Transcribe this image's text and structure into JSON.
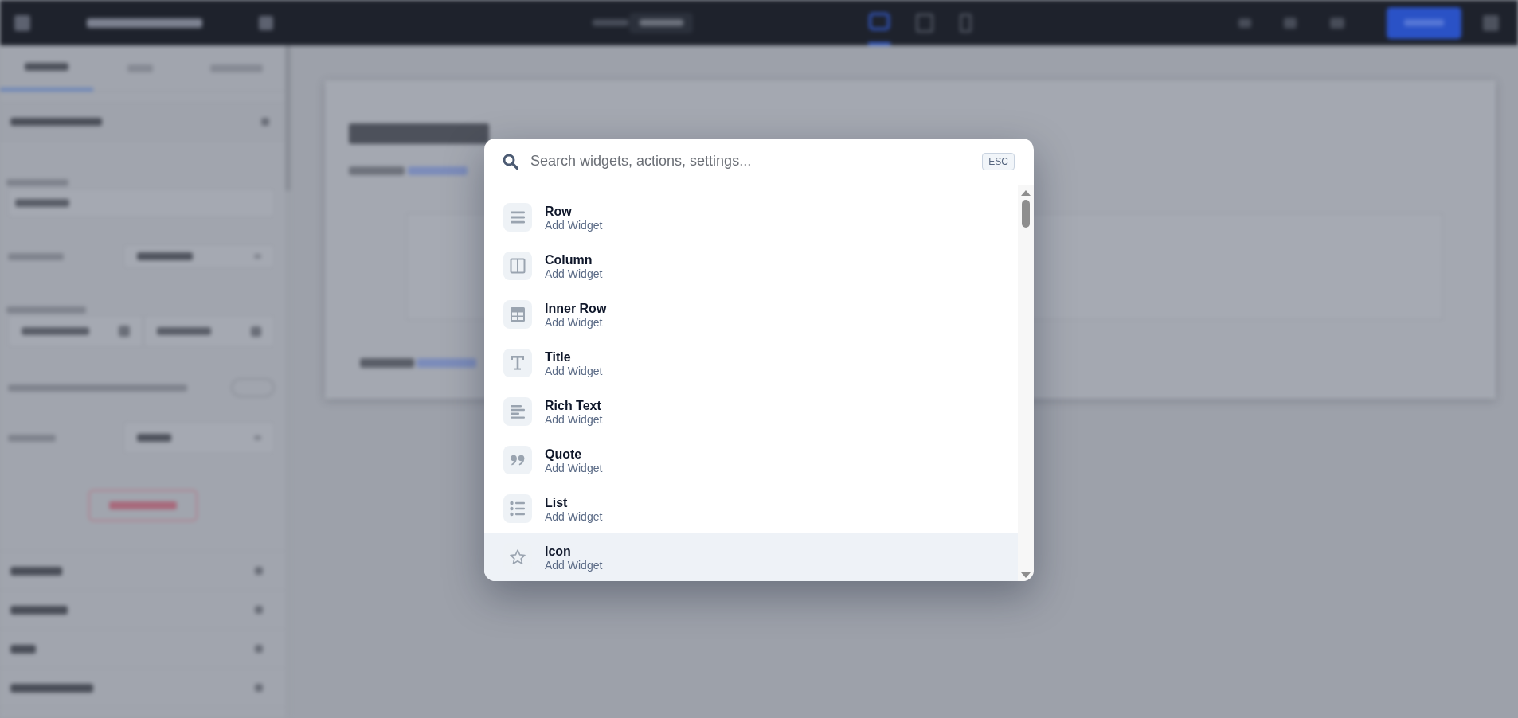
{
  "search": {
    "placeholder": "Search widgets, actions, settings...",
    "shortcut": "ESC"
  },
  "widgets": [
    {
      "kind": "row",
      "title": "Row",
      "subtitle": "Add Widget",
      "selected": false
    },
    {
      "kind": "column",
      "title": "Column",
      "subtitle": "Add Widget",
      "selected": false
    },
    {
      "kind": "innerrow",
      "title": "Inner Row",
      "subtitle": "Add Widget",
      "selected": false
    },
    {
      "kind": "title",
      "title": "Title",
      "subtitle": "Add Widget",
      "selected": false
    },
    {
      "kind": "richtext",
      "title": "Rich Text",
      "subtitle": "Add Widget",
      "selected": false
    },
    {
      "kind": "quote",
      "title": "Quote",
      "subtitle": "Add Widget",
      "selected": false
    },
    {
      "kind": "list",
      "title": "List",
      "subtitle": "Add Widget",
      "selected": false
    },
    {
      "kind": "icon",
      "title": "Icon",
      "subtitle": "Add Widget",
      "selected": true
    }
  ]
}
